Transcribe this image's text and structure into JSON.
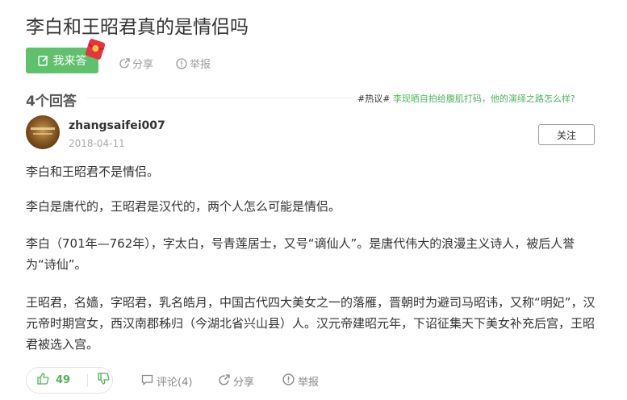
{
  "question": {
    "title": "李白和王昭君真的是情侣吗",
    "answer_button_label": "我来答",
    "share_label": "分享",
    "report_label": "举报"
  },
  "answers_header": {
    "count_label": "4个回答",
    "hot_tag": "#热议#",
    "hot_link": "李现晒自拍给腹肌打码，他的演绎之路怎么样?"
  },
  "answer": {
    "username": "zhangsaifei007",
    "date": "2018-04-11",
    "follow_label": "关注",
    "paragraphs": [
      "李白和王昭君不是情侣。",
      "李白是唐代的，王昭君是汉代的，两个人怎么可能是情侣。",
      "李白（701年—762年），字太白，号青莲居士，又号“谪仙人”。是唐代伟大的浪漫主义诗人，被后人誉为“诗仙”。",
      "王昭君，名嫱，字昭君，乳名皓月，中国古代四大美女之一的落雁，晋朝时为避司马昭讳，又称“明妃”，汉元帝时期宫女，西汉南郡秭归（今湖北省兴山县）人。汉元帝建昭元年，下诏征集天下美女补充后宫，王昭君被选入宫。"
    ],
    "upvote_count": "49",
    "comment_label": "评论(4)",
    "share_label": "分享",
    "report_label": "举报"
  },
  "colors": {
    "accent_green": "#5fc16b",
    "link_green": "#4fb35a",
    "text": "#333333",
    "muted": "#9a9a9a"
  },
  "icons": [
    "edit-icon",
    "red-envelope-icon",
    "share-icon",
    "report-icon",
    "thumbs-up-icon",
    "thumbs-down-icon",
    "comment-icon"
  ]
}
